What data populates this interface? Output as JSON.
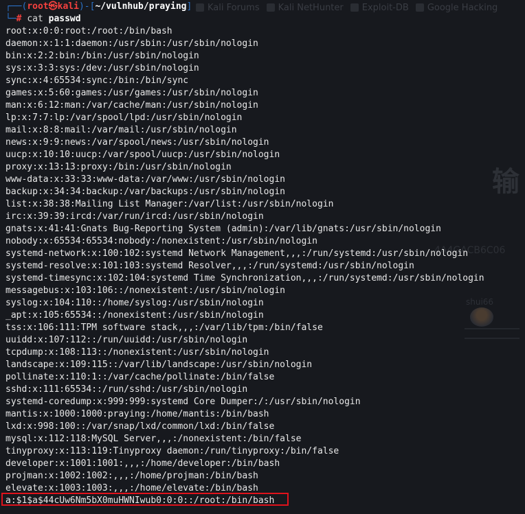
{
  "prompt": {
    "user": "root",
    "symbol": "㉿",
    "host": "kali",
    "path": "~/vulnhub/praying",
    "hash": "#",
    "command": "cat",
    "argument": "passwd"
  },
  "background_bookmarks": [
    "Kali Forums",
    "Kali NetHunter",
    "Exploit-DB",
    "Google Hacking"
  ],
  "output_lines": [
    "root:x:0:0:root:/root:/bin/bash",
    "daemon:x:1:1:daemon:/usr/sbin:/usr/sbin/nologin",
    "bin:x:2:2:bin:/bin:/usr/sbin/nologin",
    "sys:x:3:3:sys:/dev:/usr/sbin/nologin",
    "sync:x:4:65534:sync:/bin:/bin/sync",
    "games:x:5:60:games:/usr/games:/usr/sbin/nologin",
    "man:x:6:12:man:/var/cache/man:/usr/sbin/nologin",
    "lp:x:7:7:lp:/var/spool/lpd:/usr/sbin/nologin",
    "mail:x:8:8:mail:/var/mail:/usr/sbin/nologin",
    "news:x:9:9:news:/var/spool/news:/usr/sbin/nologin",
    "uucp:x:10:10:uucp:/var/spool/uucp:/usr/sbin/nologin",
    "proxy:x:13:13:proxy:/bin:/usr/sbin/nologin",
    "www-data:x:33:33:www-data:/var/www:/usr/sbin/nologin",
    "backup:x:34:34:backup:/var/backups:/usr/sbin/nologin",
    "list:x:38:38:Mailing List Manager:/var/list:/usr/sbin/nologin",
    "irc:x:39:39:ircd:/var/run/ircd:/usr/sbin/nologin",
    "gnats:x:41:41:Gnats Bug-Reporting System (admin):/var/lib/gnats:/usr/sbin/nologin",
    "nobody:x:65534:65534:nobody:/nonexistent:/usr/sbin/nologin",
    "systemd-network:x:100:102:systemd Network Management,,,:/run/systemd:/usr/sbin/nologin",
    "systemd-resolve:x:101:103:systemd Resolver,,,:/run/systemd:/usr/sbin/nologin",
    "systemd-timesync:x:102:104:systemd Time Synchronization,,,:/run/systemd:/usr/sbin/nologin",
    "messagebus:x:103:106::/nonexistent:/usr/sbin/nologin",
    "syslog:x:104:110::/home/syslog:/usr/sbin/nologin",
    "_apt:x:105:65534::/nonexistent:/usr/sbin/nologin",
    "tss:x:106:111:TPM software stack,,,:/var/lib/tpm:/bin/false",
    "uuidd:x:107:112::/run/uuidd:/usr/sbin/nologin",
    "tcpdump:x:108:113::/nonexistent:/usr/sbin/nologin",
    "landscape:x:109:115::/var/lib/landscape:/usr/sbin/nologin",
    "pollinate:x:110:1::/var/cache/pollinate:/bin/false",
    "sshd:x:111:65534::/run/sshd:/usr/sbin/nologin",
    "systemd-coredump:x:999:999:systemd Core Dumper:/:/usr/sbin/nologin",
    "mantis:x:1000:1000:praying:/home/mantis:/bin/bash",
    "lxd:x:998:100::/var/snap/lxd/common/lxd:/bin/false",
    "mysql:x:112:118:MySQL Server,,,:/nonexistent:/bin/false",
    "tinyproxy:x:113:119:Tinyproxy daemon:/run/tinyproxy:/bin/false",
    "developer:x:1001:1001:,,,:/home/developer:/bin/bash",
    "projman:x:1002:1002:,,,:/home/projman:/bin/bash",
    "elevate:x:1003:1003:,,,:/home/elevate:/bin/bash",
    "a:$1$a$44cUw6Nm5bX0muHWNIwub0:0:0::/root:/bin/bash"
  ],
  "highlight_color": "#e0121b",
  "background_page": {
    "glyph": "输",
    "hash_fragment": "4A4GACB6C06",
    "username": "shui66"
  }
}
